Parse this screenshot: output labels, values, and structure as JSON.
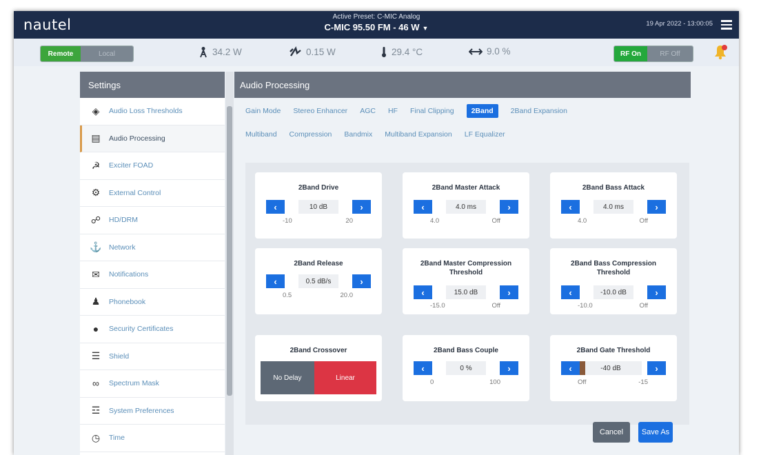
{
  "header": {
    "logo": "nautel",
    "preset_label": "Active Preset: C-MIC Analog",
    "station": "C-MIC 95.50 FM - 46 W",
    "station_dropdown": "▼",
    "datetime": "19 Apr 2022 - 13:00:05",
    "menu_icon": "hamburger-menu-icon"
  },
  "status": {
    "remote_on": "Remote",
    "remote_off": "Local",
    "forward_power": "34.2 W",
    "reflected_power": "0.15 W",
    "temperature": "29.4 °C",
    "vswr": "9.0 %",
    "rf_on": "RF On",
    "rf_off": "RF Off",
    "remote_color": "#3ca53c",
    "rf_color": "#24a83c"
  },
  "sidebar": {
    "title": "Settings",
    "items": [
      {
        "label": "Audio Loss Thresholds",
        "icon": "speaker-icon"
      },
      {
        "label": "Audio Processing",
        "icon": "audio-processing-icon"
      },
      {
        "label": "Exciter FOAD",
        "icon": "exciter-icon"
      },
      {
        "label": "External Control",
        "icon": "external-control-icon"
      },
      {
        "label": "HD/DRM",
        "icon": "hd-icon"
      },
      {
        "label": "Network",
        "icon": "network-icon"
      },
      {
        "label": "Notifications",
        "icon": "envelope-icon"
      },
      {
        "label": "Phonebook",
        "icon": "person-icon"
      },
      {
        "label": "Security Certificates",
        "icon": "certificate-icon"
      },
      {
        "label": "Shield",
        "icon": "shield-icon"
      },
      {
        "label": "Spectrum Mask",
        "icon": "spectrum-icon"
      },
      {
        "label": "System Preferences",
        "icon": "list-icon"
      },
      {
        "label": "Time",
        "icon": "clock-icon"
      }
    ]
  },
  "panel": {
    "title": "Audio Processing",
    "tabs_row1": [
      "Gain Mode",
      "Stereo Enhancer",
      "AGC",
      "HF",
      "Final Clipping",
      "2Band",
      "2Band Expansion"
    ],
    "tabs_row2": [
      "Multiband",
      "Compression",
      "Bandmix",
      "Multiband Expansion",
      "LF Equalizer"
    ],
    "active_tab": "2Band",
    "active_tab_color": "#1b6fe0"
  },
  "tiles": {
    "drive": {
      "title": "2Band Drive",
      "value": "10 dB",
      "min": "-10",
      "max": "20"
    },
    "master_attack": {
      "title": "2Band Master Attack",
      "value": "4.0 ms",
      "min": "4.0",
      "max": "Off"
    },
    "bass_attack": {
      "title": "2Band Bass Attack",
      "value": "4.0 ms",
      "min": "4.0",
      "max": "Off"
    },
    "release": {
      "title": "2Band Release",
      "value": "0.5 dB/s",
      "min": "0.5",
      "max": "20.0"
    },
    "master_threshold": {
      "title": "2Band Master Compression Threshold",
      "value": "15.0 dB",
      "min": "-15.0",
      "max": "Off"
    },
    "bass_threshold": {
      "title": "2Band Bass Compression Threshold",
      "value": "-10.0 dB",
      "min": "-10.0",
      "max": "Off"
    },
    "crossover": {
      "title": "2Band Crossover",
      "option1": "No Delay",
      "option2": "Linear",
      "selected": "Linear"
    },
    "bass_couple": {
      "title": "2Band Bass Couple",
      "value": "0 %",
      "min": "0",
      "max": "100"
    },
    "gate_threshold": {
      "title": "2Band Gate Threshold",
      "value": "-40 dB",
      "min": "Off",
      "max": "-15"
    }
  },
  "actions": {
    "cancel": "Cancel",
    "save_as": "Save As"
  }
}
